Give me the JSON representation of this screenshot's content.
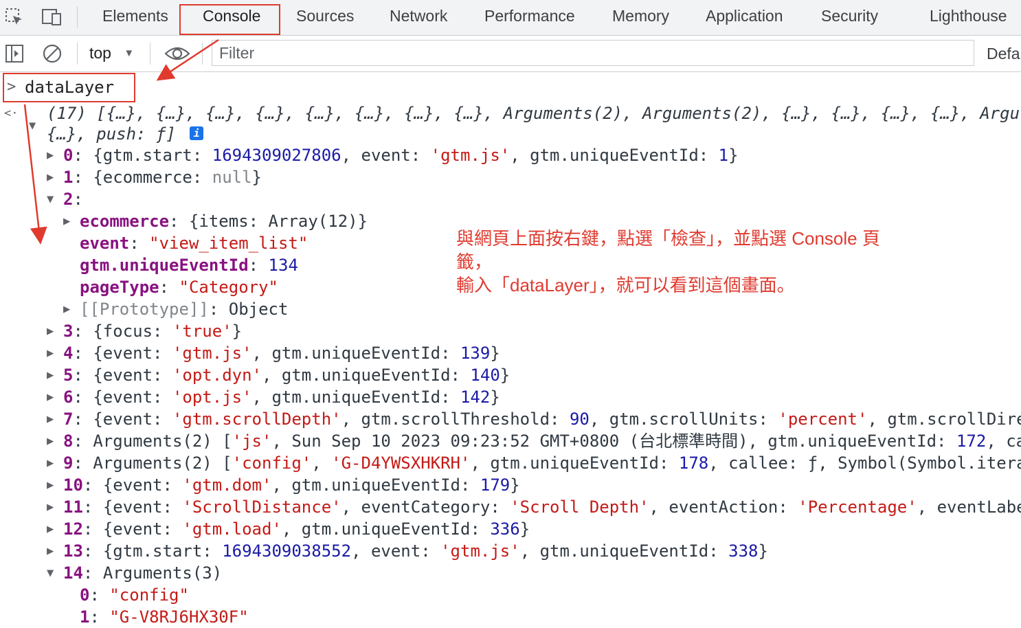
{
  "tabs": {
    "elements": "Elements",
    "console": "Console",
    "sources": "Sources",
    "network": "Network",
    "performance": "Performance",
    "memory": "Memory",
    "application": "Application",
    "security": "Security",
    "lighthouse": "Lighthouse"
  },
  "toolbar": {
    "context": "top",
    "filter_placeholder": "Filter",
    "levels": "Defa"
  },
  "console": {
    "prompt_symbol": ">",
    "input": "dataLayer",
    "result_symbol": "<·",
    "summary_line1": "(17) [{…}, {…}, {…}, {…}, {…}, {…}, {…}, {…}, Arguments(2), Arguments(2), {…}, {…}, {…}, {…}, Argu",
    "summary_line2": "{…}, push: ƒ]",
    "info_badge": "i",
    "rows": [
      {
        "idx": "0",
        "parts": [
          [
            "p",
            "{gtm.start: "
          ],
          [
            "n",
            "1694309027806"
          ],
          [
            "p",
            ", event: "
          ],
          [
            "s",
            "'gtm.js'"
          ],
          [
            "p",
            ", gtm.uniqueEventId: "
          ],
          [
            "n",
            "1"
          ],
          [
            "p",
            "}"
          ]
        ]
      },
      {
        "idx": "1",
        "parts": [
          [
            "p",
            "{ecommerce: "
          ],
          [
            "g",
            "null"
          ],
          [
            "p",
            "}"
          ]
        ]
      },
      {
        "idx": "2",
        "parts": []
      },
      {
        "idx": "3",
        "parts": [
          [
            "p",
            "{focus: "
          ],
          [
            "s",
            "'true'"
          ],
          [
            "p",
            "}"
          ]
        ]
      },
      {
        "idx": "4",
        "parts": [
          [
            "p",
            "{event: "
          ],
          [
            "s",
            "'gtm.js'"
          ],
          [
            "p",
            ", gtm.uniqueEventId: "
          ],
          [
            "n",
            "139"
          ],
          [
            "p",
            "}"
          ]
        ]
      },
      {
        "idx": "5",
        "parts": [
          [
            "p",
            "{event: "
          ],
          [
            "s",
            "'opt.dyn'"
          ],
          [
            "p",
            ", gtm.uniqueEventId: "
          ],
          [
            "n",
            "140"
          ],
          [
            "p",
            "}"
          ]
        ]
      },
      {
        "idx": "6",
        "parts": [
          [
            "p",
            "{event: "
          ],
          [
            "s",
            "'opt.js'"
          ],
          [
            "p",
            ", gtm.uniqueEventId: "
          ],
          [
            "n",
            "142"
          ],
          [
            "p",
            "}"
          ]
        ]
      },
      {
        "idx": "7",
        "parts": [
          [
            "p",
            "{event: "
          ],
          [
            "s",
            "'gtm.scrollDepth'"
          ],
          [
            "p",
            ", gtm.scrollThreshold: "
          ],
          [
            "n",
            "90"
          ],
          [
            "p",
            ", gtm.scrollUnits: "
          ],
          [
            "s",
            "'percent'"
          ],
          [
            "p",
            ", gtm.scrollDire"
          ]
        ]
      },
      {
        "idx": "8",
        "parts": [
          [
            "p",
            "Arguments(2) ["
          ],
          [
            "s",
            "'js'"
          ],
          [
            "p",
            ", Sun Sep 10 2023 09:23:52 GMT+0800 (台北標準時間), gtm.uniqueEventId: "
          ],
          [
            "n",
            "172"
          ],
          [
            "p",
            ", ca"
          ]
        ]
      },
      {
        "idx": "9",
        "parts": [
          [
            "p",
            "Arguments(2) ["
          ],
          [
            "s",
            "'config'"
          ],
          [
            "p",
            ", "
          ],
          [
            "s",
            "'G-D4YWSXHKRH'"
          ],
          [
            "p",
            ", gtm.uniqueEventId: "
          ],
          [
            "n",
            "178"
          ],
          [
            "p",
            ", callee: ƒ, Symbol(Symbol.itera"
          ]
        ]
      },
      {
        "idx": "10",
        "parts": [
          [
            "p",
            "{event: "
          ],
          [
            "s",
            "'gtm.dom'"
          ],
          [
            "p",
            ", gtm.uniqueEventId: "
          ],
          [
            "n",
            "179"
          ],
          [
            "p",
            "}"
          ]
        ]
      },
      {
        "idx": "11",
        "parts": [
          [
            "p",
            "{event: "
          ],
          [
            "s",
            "'ScrollDistance'"
          ],
          [
            "p",
            ", eventCategory: "
          ],
          [
            "s",
            "'Scroll Depth'"
          ],
          [
            "p",
            ", eventAction: "
          ],
          [
            "s",
            "'Percentage'"
          ],
          [
            "p",
            ", eventLabe"
          ]
        ]
      },
      {
        "idx": "12",
        "parts": [
          [
            "p",
            "{event: "
          ],
          [
            "s",
            "'gtm.load'"
          ],
          [
            "p",
            ", gtm.uniqueEventId: "
          ],
          [
            "n",
            "336"
          ],
          [
            "p",
            "}"
          ]
        ]
      },
      {
        "idx": "13",
        "parts": [
          [
            "p",
            "{gtm.start: "
          ],
          [
            "n",
            "1694309038552"
          ],
          [
            "p",
            ", event: "
          ],
          [
            "s",
            "'gtm.js'"
          ],
          [
            "p",
            ", gtm.uniqueEventId: "
          ],
          [
            "n",
            "338"
          ],
          [
            "p",
            "}"
          ]
        ]
      },
      {
        "idx": "14",
        "parts": [
          [
            "p",
            "Arguments(3)"
          ]
        ]
      }
    ],
    "item2": {
      "ecommerce_key": "ecommerce",
      "ecommerce_val": "{items: Array(12)}",
      "event_key": "event",
      "event_val": "\"view_item_list\"",
      "uid_key": "gtm.uniqueEventId",
      "uid_val": "134",
      "pagetype_key": "pageType",
      "pagetype_val": "\"Category\"",
      "proto_key": "[[Prototype]]",
      "proto_val": "Object"
    },
    "item14": {
      "k0": "0",
      "v0": "\"config\"",
      "k1": "1",
      "v1": "\"G-V8RJ6HX30F\""
    }
  },
  "annotation": {
    "line1": "與網頁上面按右鍵，點選「檢查」，並點選 Console 頁",
    "line2": "籤，",
    "line3": "輸入「dataLayer」，就可以看到這個畫面。"
  },
  "colors": {
    "annotation_red": "#e03a2f",
    "key_purple": "#881280",
    "string_red": "#c41a16",
    "number_blue": "#1a1aa6"
  }
}
